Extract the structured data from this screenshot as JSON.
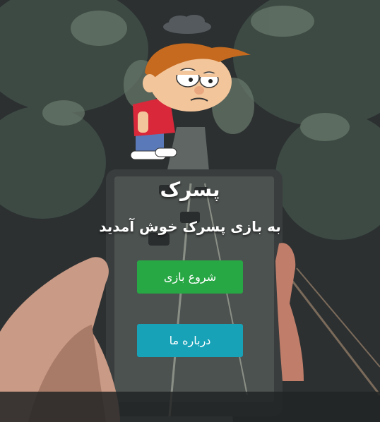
{
  "game": {
    "title": "پسرک",
    "welcome": "به بازی پسرک خوش آمدید"
  },
  "menu": {
    "start_label": "شروع بازی",
    "about_label": "درباره ما"
  },
  "colors": {
    "start": "#28a745",
    "about": "#17a2b8",
    "background": "#2a2d2e"
  },
  "icons": {
    "hero": "cartoon-boy-icon",
    "cloud": "rain-cloud-icon"
  }
}
